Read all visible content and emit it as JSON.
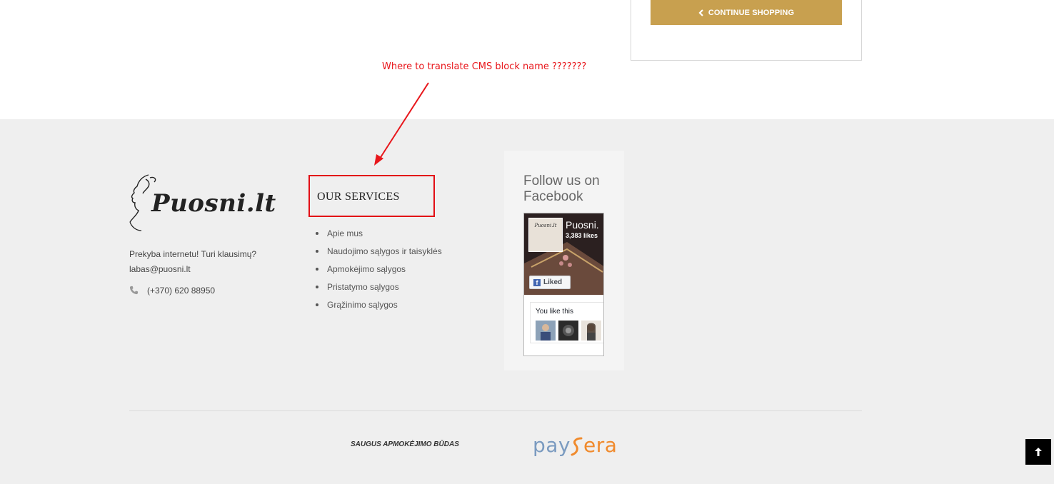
{
  "cart": {
    "continue_label": "CONTINUE SHOPPING"
  },
  "annotation": {
    "text": "Where to translate CMS block name ???????",
    "color": "#e8161b"
  },
  "brand": {
    "logo_text": "Puosni.lt",
    "tagline": "Prekyba internetu! Turi klausimų?",
    "email": "labas@puosni.lt",
    "phone": "(+370) 620 88950"
  },
  "services": {
    "title": "OUR SERVICES",
    "items": [
      "Apie mus",
      "Naudojimo sąlygos ir taisyklės",
      "Apmokėjimo sąlygos",
      "Pristatymo sąlygos",
      "Grąžinimo sąlygos"
    ]
  },
  "facebook": {
    "title": "Follow us on Facebook",
    "page_name": "Puosni.",
    "likes": "3,383 likes",
    "liked_label": "Liked",
    "you_like": "You like this",
    "thumb_text": "Puosni.lt"
  },
  "footer": {
    "secure_payment": "SAUGUS APMOKĖJIMO BŪDAS",
    "payment_logo_left": "pay",
    "payment_logo_right": "era"
  },
  "colors": {
    "accent_gold": "#c8a04f",
    "footer_bg": "#efefef",
    "highlight_red": "#e20e15",
    "paysera_blue": "#7b9bc0",
    "paysera_orange": "#f08a2c"
  },
  "icons": {
    "continue": "chevron-left-icon",
    "phone": "phone-icon",
    "to_top": "arrow-up-icon"
  }
}
